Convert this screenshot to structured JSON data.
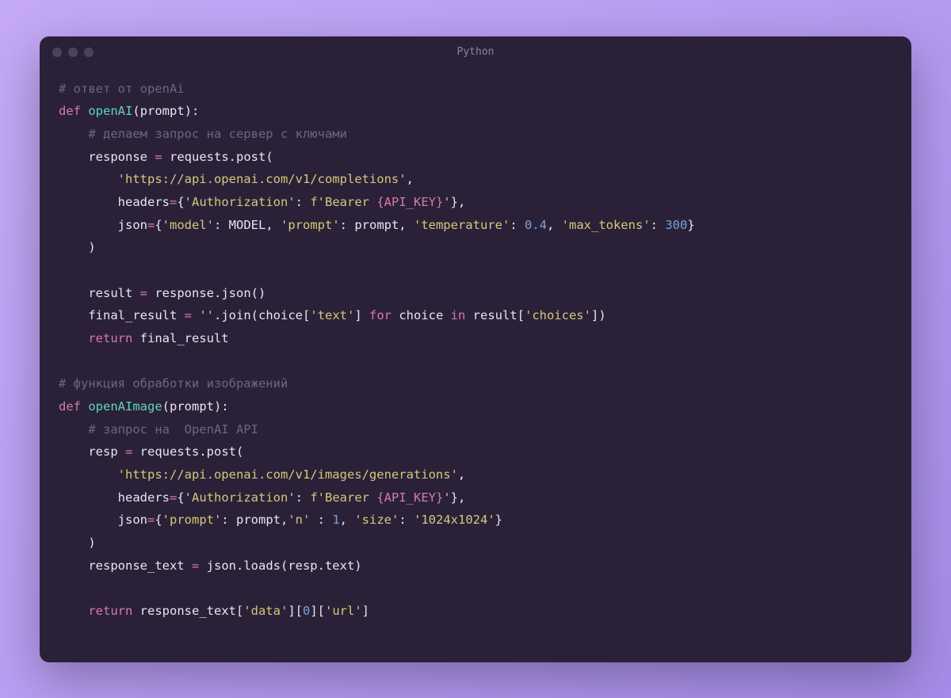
{
  "window": {
    "title": "Python"
  },
  "code": {
    "l1_comment": "# ответ от openAi",
    "l2_def": "def",
    "l2_func": "openAI",
    "l2_paren_open": "(",
    "l2_param": "prompt",
    "l2_paren_close": "):",
    "l3_comment": "    # делаем запрос на сервер с ключами",
    "l4_var": "    response ",
    "l4_eq": "=",
    "l4_call": " requests.post(",
    "l5_str": "        'https://api.openai.com/v1/completions'",
    "l5_comma": ",",
    "l6_pre": "        headers",
    "l6_eq": "=",
    "l6_brace": "{",
    "l6_key": "'Authorization'",
    "l6_colon": ": ",
    "l6_fpre": "f'Bearer ",
    "l6_fexpr": "{API_KEY}",
    "l6_fpost": "'",
    "l6_close": "},",
    "l7_pre": "        json",
    "l7_eq": "=",
    "l7_brace": "{",
    "l7_k1": "'model'",
    "l7_c1": ": MODEL, ",
    "l7_k2": "'prompt'",
    "l7_c2": ": prompt, ",
    "l7_k3": "'temperature'",
    "l7_c3": ": ",
    "l7_n1": "0.4",
    "l7_c4": ", ",
    "l7_k4": "'max_tokens'",
    "l7_c5": ": ",
    "l7_n2": "300",
    "l7_close": "}",
    "l8": "    )",
    "l9": "",
    "l10": "    result ",
    "l10_eq": "=",
    "l10_rest": " response.json()",
    "l11_a": "    final_result ",
    "l11_eq": "=",
    "l11_b": " ",
    "l11_str": "''",
    "l11_c": ".join(choice[",
    "l11_key": "'text'",
    "l11_d": "] ",
    "l11_for": "for",
    "l11_e": " choice ",
    "l11_in": "in",
    "l11_f": " result[",
    "l11_key2": "'choices'",
    "l11_g": "])",
    "l12_ret": "    return",
    "l12_val": " final_result",
    "l13": "",
    "l14_comment": "# функция обработки изображений",
    "l15_def": "def",
    "l15_func": " openAImage",
    "l15_paren_open": "(",
    "l15_param": "prompt",
    "l15_paren_close": "):",
    "l16_comment": "    # запрос на  OpenAI API",
    "l17_var": "    resp ",
    "l17_eq": "=",
    "l17_call": " requests.post(",
    "l18_str": "        'https://api.openai.com/v1/images/generations'",
    "l18_comma": ",",
    "l19_pre": "        headers",
    "l19_eq": "=",
    "l19_brace": "{",
    "l19_key": "'Authorization'",
    "l19_colon": ": ",
    "l19_fpre": "f'Bearer ",
    "l19_fexpr": "{API_KEY}",
    "l19_fpost": "'",
    "l19_close": "},",
    "l20_pre": "        json",
    "l20_eq": "=",
    "l20_brace": "{",
    "l20_k1": "'prompt'",
    "l20_c1": ": prompt,",
    "l20_k2": "'n'",
    "l20_c2": " : ",
    "l20_n1": "1",
    "l20_c3": ", ",
    "l20_k3": "'size'",
    "l20_c4": ": ",
    "l20_v3": "'1024x1024'",
    "l20_close": "}",
    "l21": "    )",
    "l22_a": "    response_text ",
    "l22_eq": "=",
    "l22_b": " json.loads(resp.text)",
    "l23": "",
    "l24_ret": "    return",
    "l24_a": " response_text[",
    "l24_k1": "'data'",
    "l24_b": "][",
    "l24_n": "0",
    "l24_c": "][",
    "l24_k2": "'url'",
    "l24_d": "]"
  }
}
